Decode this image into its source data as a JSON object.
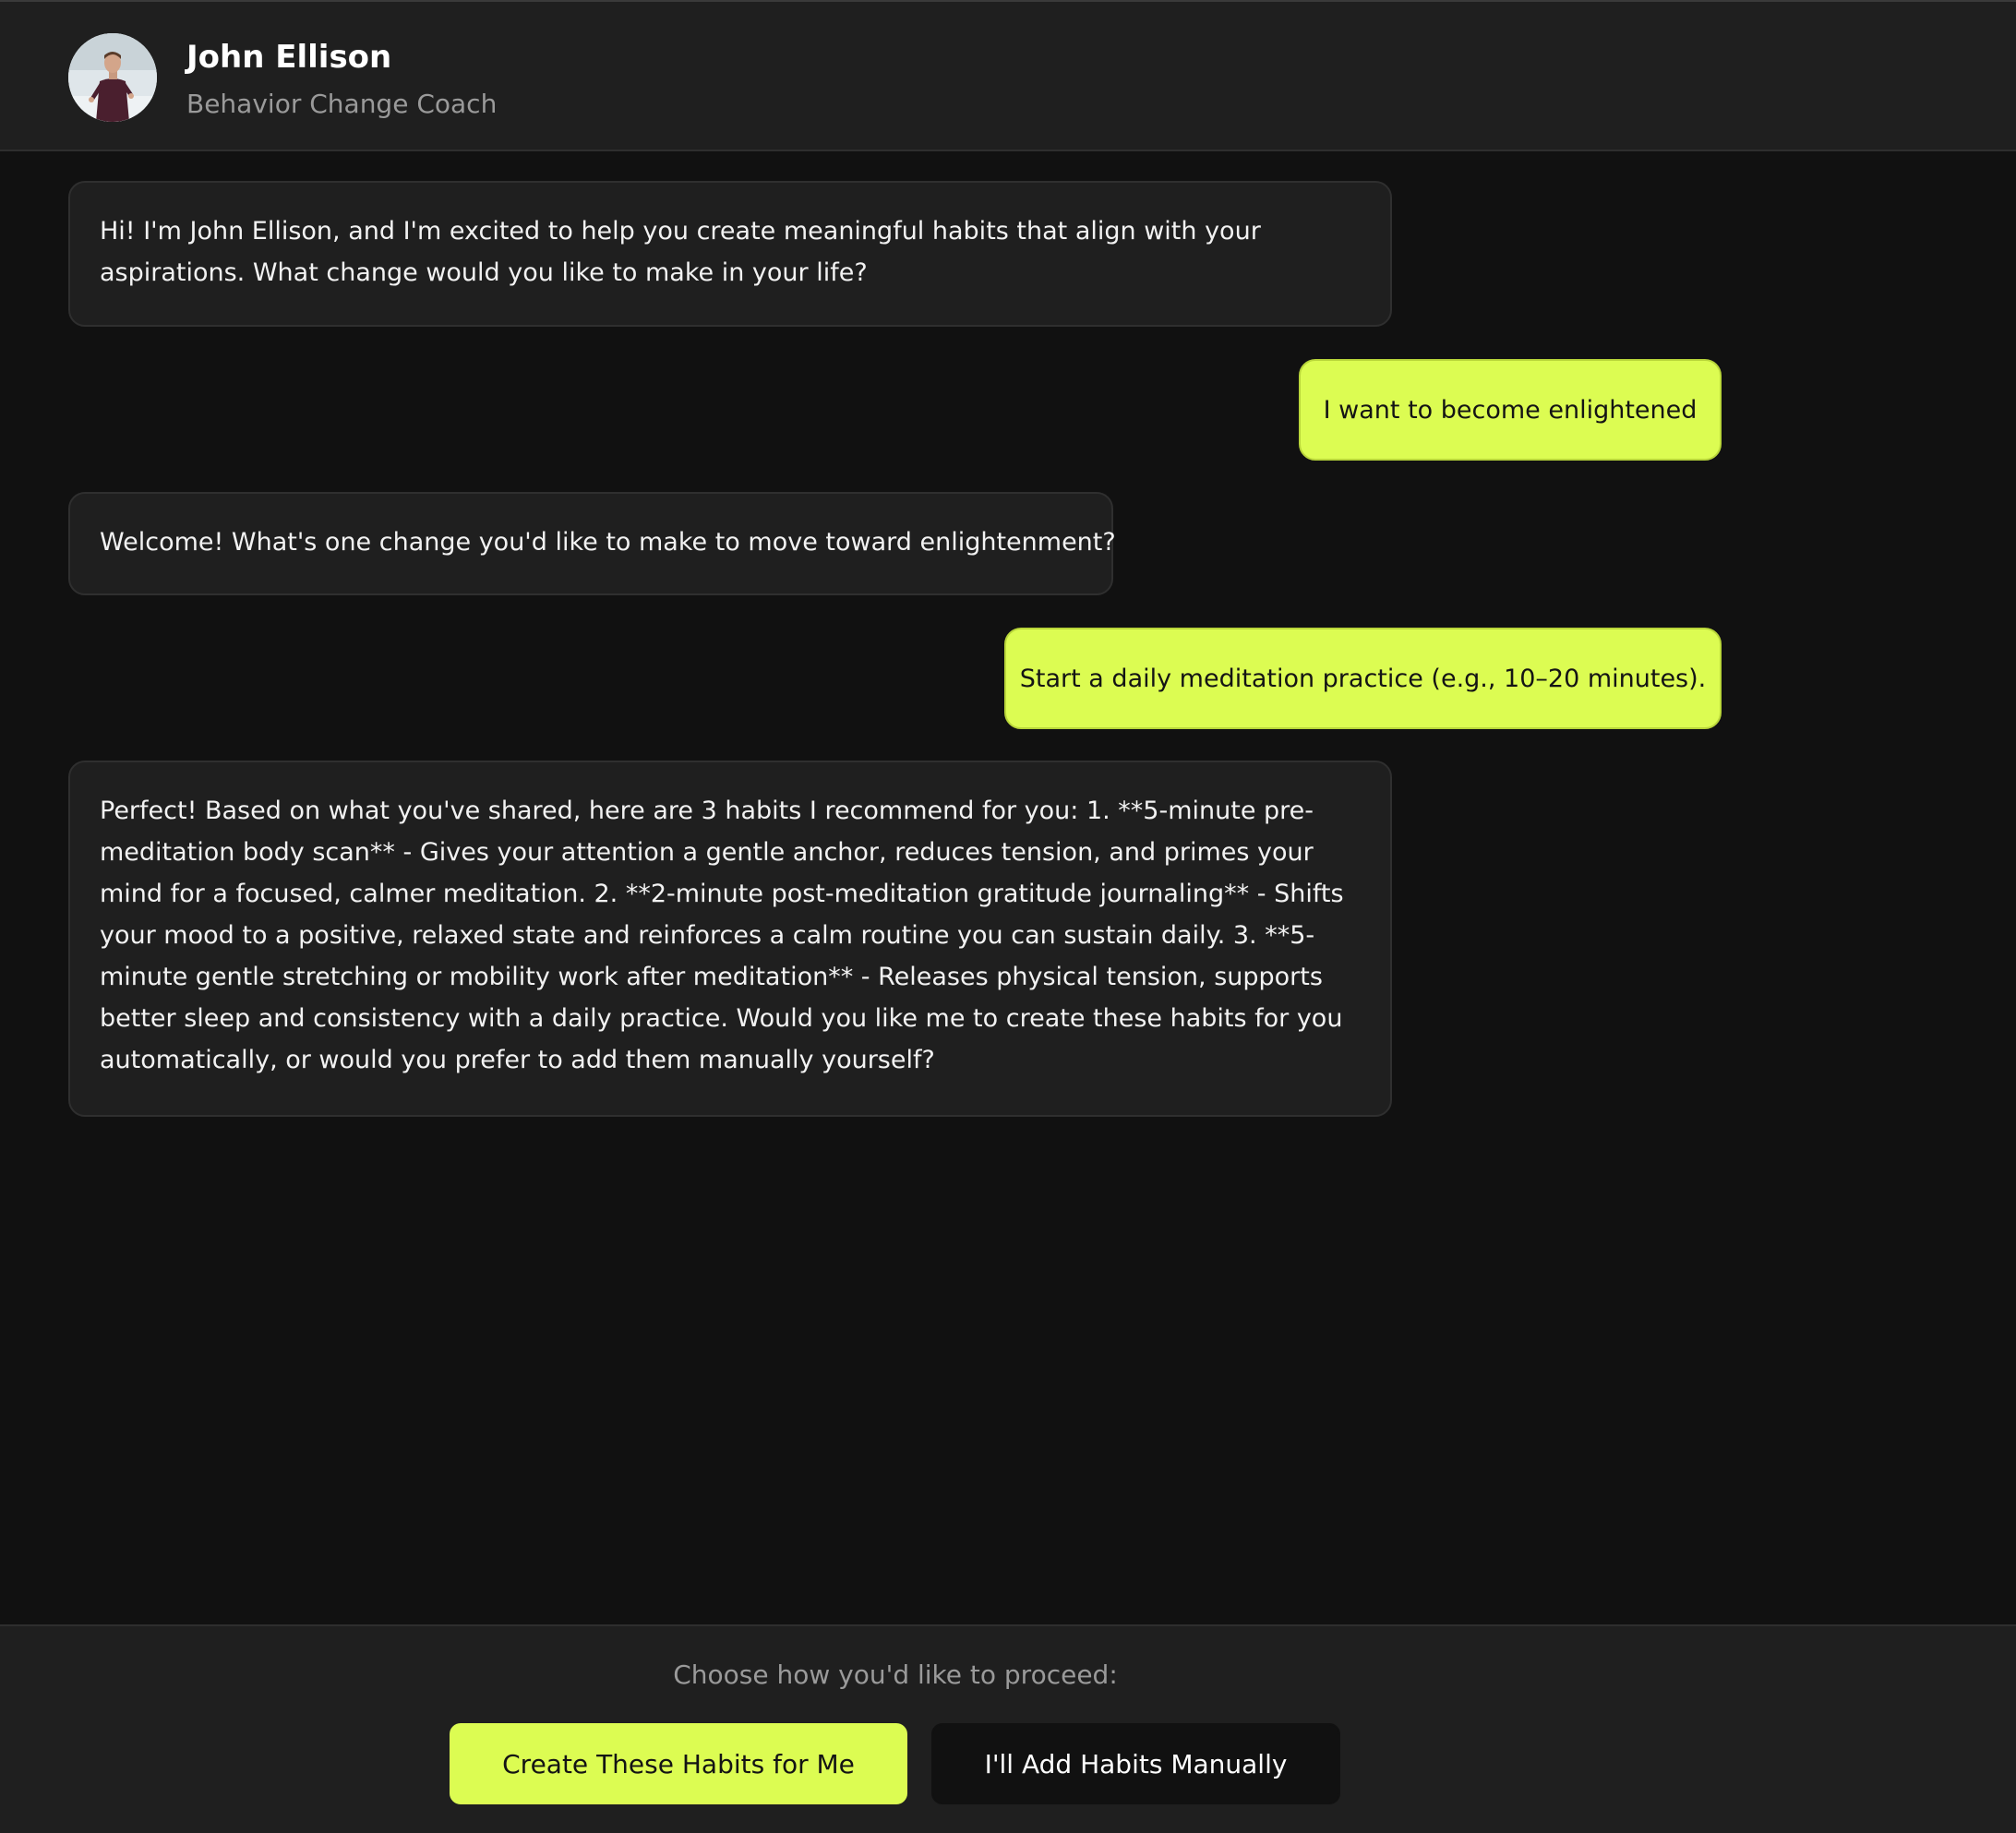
{
  "header": {
    "coach_name": "John Ellison",
    "coach_role": "Behavior Change Coach",
    "avatar_icon": "coach-avatar-photo"
  },
  "messages": [
    {
      "sender": "coach",
      "text": "Hi! I'm John Ellison, and I'm excited to help you create meaningful habits that align with your aspirations. What change would you like to make in your life?"
    },
    {
      "sender": "user",
      "text": "I want to become enlightened"
    },
    {
      "sender": "coach",
      "text": "Welcome! What's one change you'd like to make to move toward enlightenment?"
    },
    {
      "sender": "user",
      "text": "Start a daily meditation practice (e.g., 10–20 minutes)."
    },
    {
      "sender": "coach",
      "text": "Perfect! Based on what you've shared, here are 3 habits I recommend for you: 1. **5-minute pre-meditation body scan** - Gives your attention a gentle anchor, reduces tension, and primes your mind for a focused, calmer meditation. 2. **2-minute post-meditation gratitude journaling** - Shifts your mood to a positive, relaxed state and reinforces a calm routine you can sustain daily. 3. **5-minute gentle stretching or mobility work after meditation** - Releases physical tension, supports better sleep and consistency with a daily practice. Would you like me to create these habits for you automatically, or would you prefer to add them manually yourself?"
    }
  ],
  "footer": {
    "prompt": "Choose how you'd like to proceed:",
    "primary_button": "Create These Habits for Me",
    "secondary_button": "I'll Add Habits Manually"
  },
  "colors": {
    "background": "#111111",
    "panel": "#1f1f1f",
    "accent": "#dcfc52",
    "text_primary": "#ffffff",
    "text_muted": "#9a9a9a"
  }
}
